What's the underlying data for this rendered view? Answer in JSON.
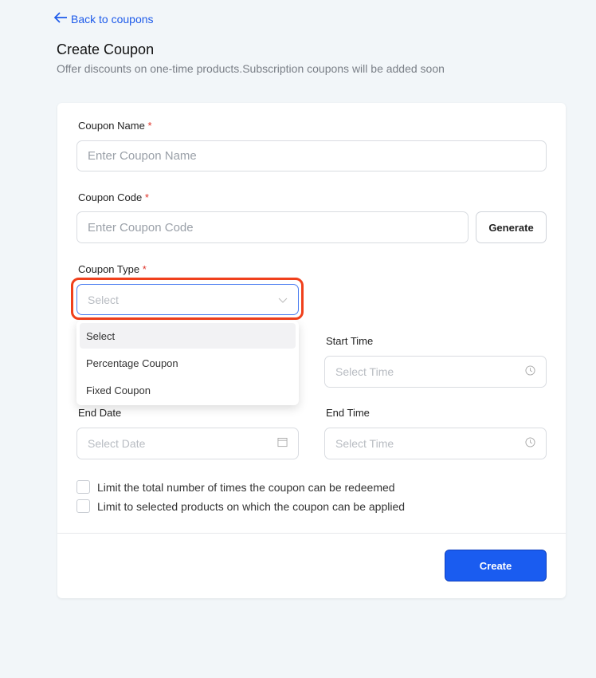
{
  "header": {
    "back_label": "Back to coupons",
    "title": "Create Coupon",
    "subtitle": "Offer discounts on one-time products.Subscription coupons will be added soon"
  },
  "form": {
    "coupon_name": {
      "label": "Coupon Name",
      "required": "*",
      "placeholder": "Enter Coupon Name"
    },
    "coupon_code": {
      "label": "Coupon Code",
      "required": "*",
      "placeholder": "Enter Coupon Code",
      "generate_label": "Generate"
    },
    "coupon_type": {
      "label": "Coupon Type",
      "required": "*",
      "placeholder": "Select",
      "options": [
        "Select",
        "Percentage Coupon",
        "Fixed Coupon"
      ]
    },
    "start_time": {
      "label": "Start Time",
      "placeholder": "Select Time"
    },
    "end_date": {
      "label": "End Date",
      "placeholder": "Select Date"
    },
    "end_time": {
      "label": "End Time",
      "placeholder": "Select Time"
    },
    "checkboxes": [
      "Limit the total number of times the coupon can be redeemed",
      "Limit to selected products on which the coupon can be applied"
    ],
    "create_label": "Create"
  },
  "colors": {
    "accent": "#1a5cf0",
    "highlight": "#f0401c"
  }
}
